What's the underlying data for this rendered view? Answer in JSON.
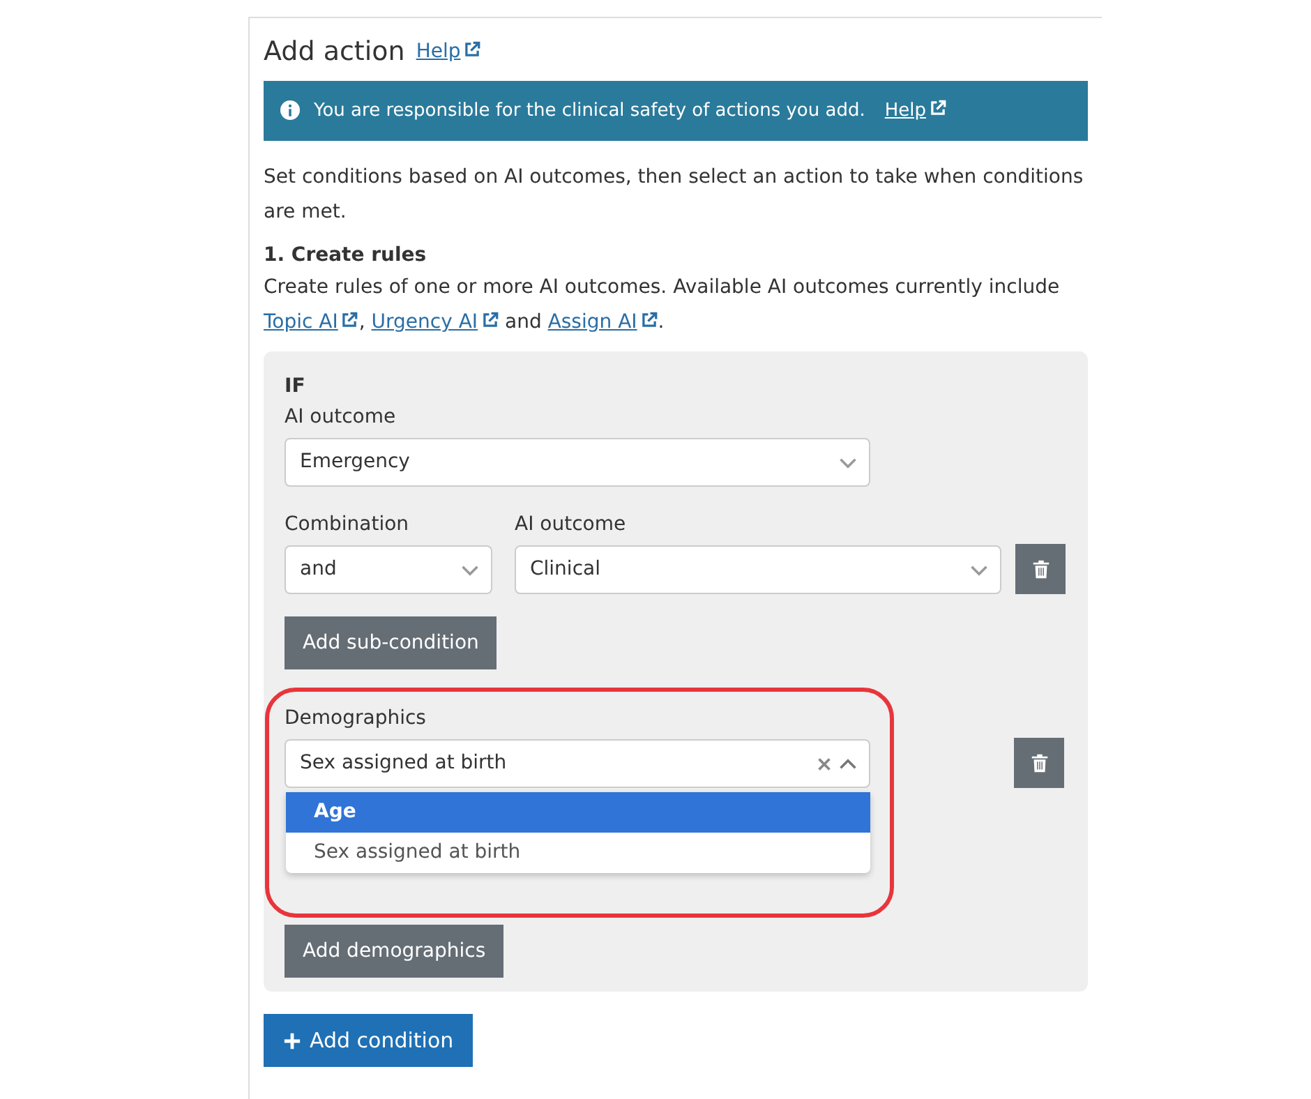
{
  "title": "Add action",
  "title_link": "Help",
  "alert": {
    "text": "You are responsible for the clinical safety of actions you add.",
    "link": "Help"
  },
  "intro": "Set conditions based on AI outcomes, then select an action to take when conditions are met.",
  "step": {
    "heading": "1. Create rules",
    "parts": [
      {
        "kind": "text",
        "text": "Create rules of one or more AI outcomes. Available AI outcomes currently include "
      },
      {
        "kind": "link",
        "text": "Topic AI"
      },
      {
        "kind": "text",
        "text": ", "
      },
      {
        "kind": "link",
        "text": "Urgency AI"
      },
      {
        "kind": "text",
        "text": " and "
      },
      {
        "kind": "link",
        "text": "Assign AI"
      },
      {
        "kind": "text",
        "text": "."
      }
    ]
  },
  "rule": {
    "if_label": "IF",
    "outcome": {
      "label": "AI outcome",
      "value": "Emergency"
    },
    "sub_conditions": [
      {
        "combination_label": "Combination",
        "combination": "and",
        "outcome_label": "AI outcome",
        "outcome": "Clinical"
      }
    ],
    "add_sub_button": "Add sub-condition",
    "demographics": {
      "label": "Demographics",
      "value": "Sex assigned at birth",
      "expanded": true,
      "highlighted": true,
      "options": [
        {
          "label": "Age",
          "highlighted": true
        },
        {
          "label": "Sex assigned at birth",
          "highlighted": false
        }
      ]
    },
    "add_demographics_button": "Add demographics"
  },
  "add_condition_button": "Add condition"
}
